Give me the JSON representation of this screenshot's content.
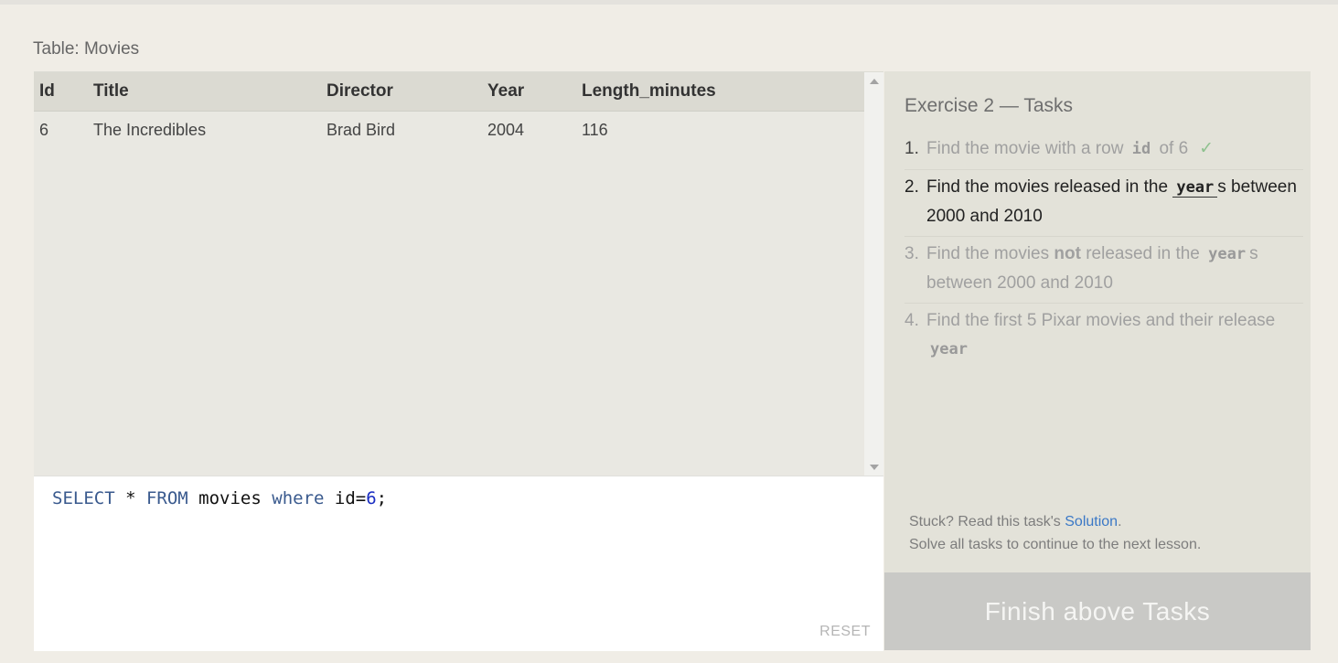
{
  "table_caption": "Table: Movies",
  "results": {
    "columns": [
      "Id",
      "Title",
      "Director",
      "Year",
      "Length_minutes"
    ],
    "rows": [
      [
        "6",
        "The Incredibles",
        "Brad Bird",
        "2004",
        "116"
      ]
    ]
  },
  "editor": {
    "query_parts": [
      "SELECT",
      " * ",
      "FROM",
      " movies ",
      "where",
      " id=",
      "6",
      ";"
    ],
    "reset_label": "RESET"
  },
  "tasks": {
    "title": "Exercise 2 — Tasks",
    "items": [
      {
        "num": "1.",
        "pre": "Find the movie with a row",
        "code": "id",
        "post": "of 6",
        "check": "✓"
      },
      {
        "num": "2.",
        "pre": "Find the movies released in the",
        "code": "year",
        "post": "s between 2000 and 2010"
      },
      {
        "num": "3.",
        "pre": "Find the movies",
        "bold": "not",
        "mid": "released in the",
        "code": "year",
        "post": "s between 2000 and 2010"
      },
      {
        "num": "4.",
        "pre": "Find the first 5 Pixar movies and their release",
        "code": "year"
      }
    ]
  },
  "hint": {
    "prefix": "Stuck? Read this task's",
    "link": "Solution",
    "suffix": ".",
    "line2": "Solve all tasks to continue to the next lesson."
  },
  "finish_label": "Finish above Tasks",
  "colors": {
    "keyword": "#3a5a8e",
    "number": "#1a2dc2",
    "link": "#3b78c6",
    "check": "#8fc18f"
  }
}
